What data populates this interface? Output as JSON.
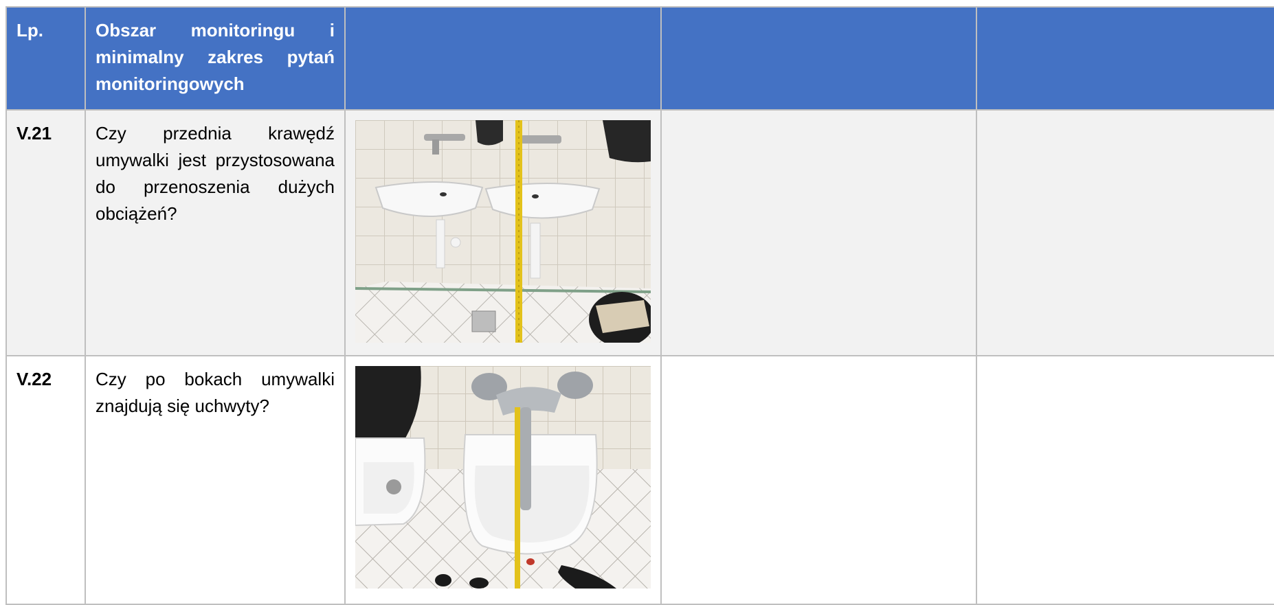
{
  "table": {
    "headers": {
      "lp": "Lp.",
      "area": "Obszar monitoringu i minimalny zakres pytań monitoringowych",
      "col3": "",
      "col4": "",
      "col5": ""
    },
    "rows": [
      {
        "lp": "V.21",
        "question": "Czy przednia krawędź umywalki jest przystosowana do przenoszenia dużych obciążeń?",
        "photo": "photo of two wall-mounted washbasins measured with a yellow tape measure",
        "col4": "",
        "col5": ""
      },
      {
        "lp": "V.22",
        "question": "Czy po bokach umywalki znajdują się uchwyty?",
        "photo": "top-down photo of a washbasin with faucet and tape measure",
        "col4": "",
        "col5": ""
      }
    ]
  },
  "colors": {
    "header_bg": "#4472c4",
    "header_text": "#ffffff",
    "row_shaded": "#f2f2f2",
    "border": "#bfbfbf"
  }
}
